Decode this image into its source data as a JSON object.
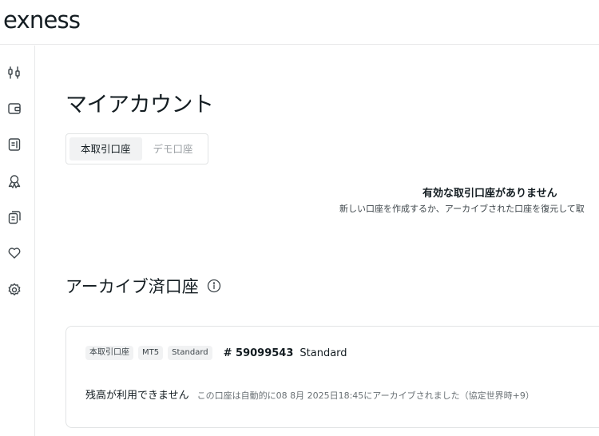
{
  "header": {
    "logo": "exness"
  },
  "sidebar": {
    "icons": [
      "trade-icon",
      "wallet-icon",
      "document-icon",
      "rewards-icon",
      "copy-icon",
      "heart-icon",
      "settings-icon"
    ]
  },
  "main": {
    "title": "マイアカウント",
    "tabs": [
      {
        "label": "本取引口座",
        "active": true
      },
      {
        "label": "デモ口座",
        "active": false
      }
    ],
    "empty_state": {
      "title": "有効な取引口座がありません",
      "subtitle": "新しい口座を作成するか、アーカイブされた口座を復元して取"
    },
    "archive": {
      "title": "アーカイブ済口座",
      "account": {
        "tags": [
          "本取引口座",
          "MT5",
          "Standard"
        ],
        "number": "# 59099543",
        "type": "Standard",
        "status": "残高が利用できません",
        "note": "この口座は自動的に08 8月 2025日18:45にアーカイブされました（協定世界時+9）"
      }
    }
  },
  "colors": {
    "text": "#141d22",
    "border": "#e2e4e5",
    "tab_active_bg": "#f1f2f3"
  }
}
